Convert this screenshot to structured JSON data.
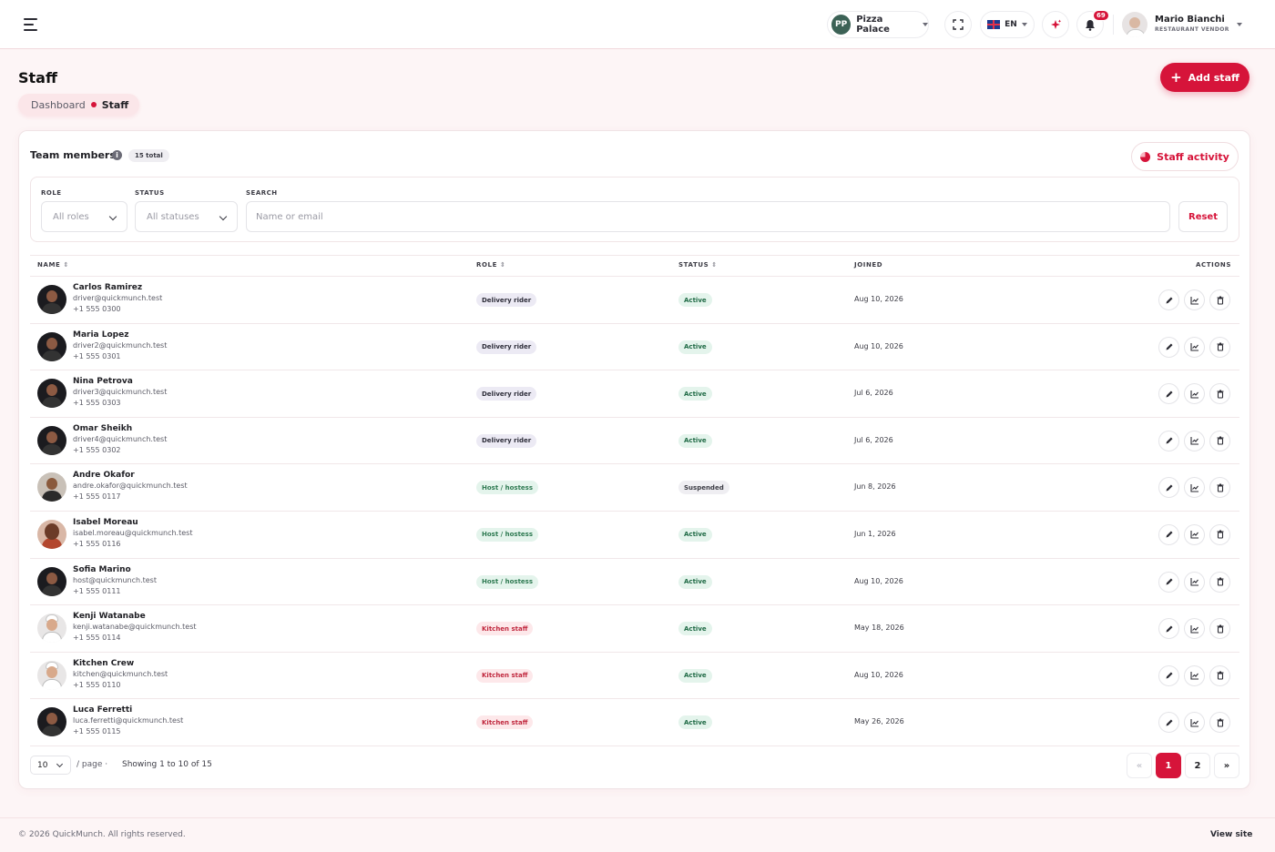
{
  "header": {
    "restaurant": {
      "initials": "PP",
      "name": "Pizza Palace"
    },
    "language": "EN",
    "notification_count": "69",
    "user": {
      "name": "Mario Bianchi",
      "role": "RESTAURANT VENDOR"
    }
  },
  "page": {
    "title": "Staff",
    "breadcrumb": [
      "Dashboard",
      "Staff"
    ],
    "add_button": "Add staff"
  },
  "card": {
    "title": "Team members",
    "info_icon": "i",
    "total_badge": "15 total",
    "activity_button": "Staff activity"
  },
  "filters": {
    "role_label": "ROLE",
    "role_value": "All roles",
    "status_label": "STATUS",
    "status_value": "All statuses",
    "search_label": "SEARCH",
    "search_placeholder": "Name or email",
    "reset": "Reset"
  },
  "table": {
    "columns": {
      "name": "NAME",
      "role": "ROLE",
      "status": "STATUS",
      "joined": "JOINED",
      "actions": "ACTIONS"
    },
    "sort_glyph": "⇕",
    "rows": [
      {
        "name": "Carlos Ramirez",
        "email": "driver@quickmunch.test",
        "phone": "+1 555 0300",
        "role": "Delivery rider",
        "status": "Active",
        "joined": "Aug 10, 2026"
      },
      {
        "name": "Maria Lopez",
        "email": "driver2@quickmunch.test",
        "phone": "+1 555 0301",
        "role": "Delivery rider",
        "status": "Active",
        "joined": "Aug 10, 2026"
      },
      {
        "name": "Nina Petrova",
        "email": "driver3@quickmunch.test",
        "phone": "+1 555 0303",
        "role": "Delivery rider",
        "status": "Active",
        "joined": "Jul 6, 2026"
      },
      {
        "name": "Omar Sheikh",
        "email": "driver4@quickmunch.test",
        "phone": "+1 555 0302",
        "role": "Delivery rider",
        "status": "Active",
        "joined": "Jul 6, 2026"
      },
      {
        "name": "Andre Okafor",
        "email": "andre.okafor@quickmunch.test",
        "phone": "+1 555 0117",
        "role": "Host / hostess",
        "status": "Suspended",
        "joined": "Jun 8, 2026"
      },
      {
        "name": "Isabel Moreau",
        "email": "isabel.moreau@quickmunch.test",
        "phone": "+1 555 0116",
        "role": "Host / hostess",
        "status": "Active",
        "joined": "Jun 1, 2026"
      },
      {
        "name": "Sofia Marino",
        "email": "host@quickmunch.test",
        "phone": "+1 555 0111",
        "role": "Host / hostess",
        "status": "Active",
        "joined": "Aug 10, 2026"
      },
      {
        "name": "Kenji Watanabe",
        "email": "kenji.watanabe@quickmunch.test",
        "phone": "+1 555 0114",
        "role": "Kitchen staff",
        "status": "Active",
        "joined": "May 18, 2026"
      },
      {
        "name": "Kitchen Crew",
        "email": "kitchen@quickmunch.test",
        "phone": "+1 555 0110",
        "role": "Kitchen staff",
        "status": "Active",
        "joined": "Aug 10, 2026"
      },
      {
        "name": "Luca Ferretti",
        "email": "luca.ferretti@quickmunch.test",
        "phone": "+1 555 0115",
        "role": "Kitchen staff",
        "status": "Active",
        "joined": "May 26, 2026"
      }
    ]
  },
  "pagination": {
    "per_page": "10",
    "per_page_label": "/ page  ·",
    "showing": "Showing 1 to 10 of 15",
    "prev": "«",
    "pages": [
      "1",
      "2"
    ],
    "next": "»",
    "current_page": "1"
  },
  "footer": {
    "copyright": "© 2026 QuickMunch. All rights reserved.",
    "view_site": "View site"
  },
  "colors": {
    "accent": "#d6143a",
    "background": "#fdf5f6"
  }
}
